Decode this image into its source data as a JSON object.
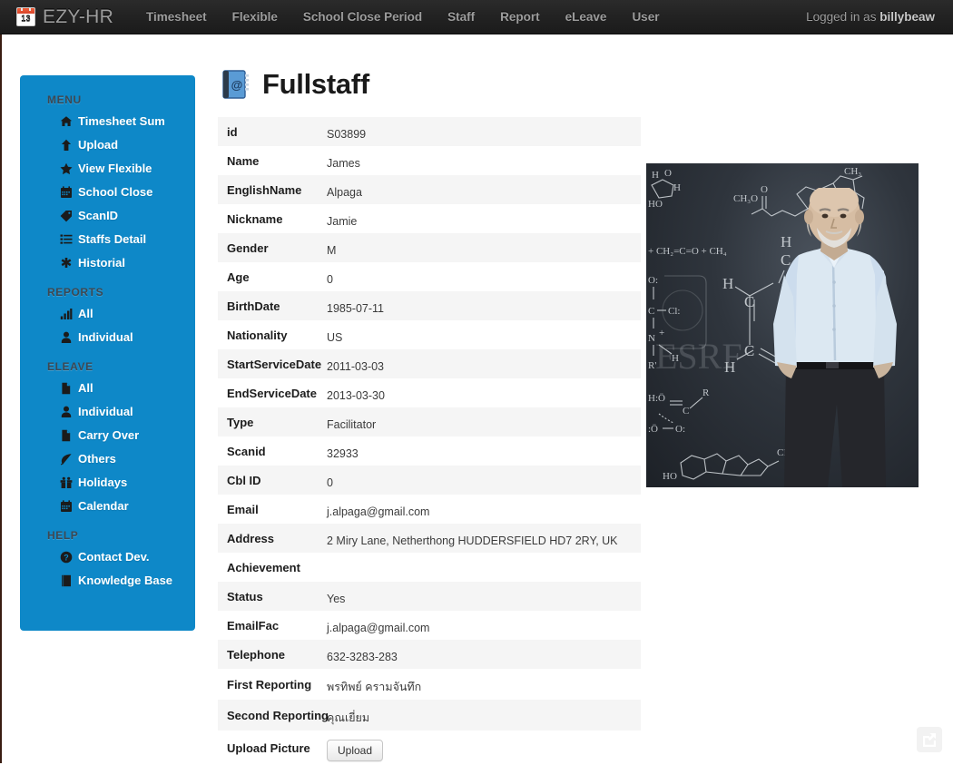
{
  "navbar": {
    "brand": "EZY-HR",
    "brand_icon": "calendar-icon",
    "calendar_day": "13",
    "items": [
      {
        "label": "Timesheet"
      },
      {
        "label": "Flexible"
      },
      {
        "label": "School Close Period"
      },
      {
        "label": "Staff"
      },
      {
        "label": "Report"
      },
      {
        "label": "eLeave"
      },
      {
        "label": "User"
      }
    ],
    "logged_in_prefix": "Logged in as",
    "username": "billybeaw"
  },
  "sidebar": {
    "accent_color": "#0e88c8",
    "sections": [
      {
        "title": "MENU",
        "items": [
          {
            "label": "Timesheet Sum",
            "icon": "home-icon"
          },
          {
            "label": "Upload",
            "icon": "arrow-up-icon"
          },
          {
            "label": "View Flexible",
            "icon": "star-icon"
          },
          {
            "label": "School Close",
            "icon": "calendar-icon"
          },
          {
            "label": "ScanID",
            "icon": "tag-icon"
          },
          {
            "label": "Staffs Detail",
            "icon": "list-icon"
          },
          {
            "label": "Historial",
            "icon": "asterisk-icon"
          }
        ]
      },
      {
        "title": "REPORTS",
        "items": [
          {
            "label": "All",
            "icon": "bar-chart-icon"
          },
          {
            "label": "Individual",
            "icon": "user-icon"
          }
        ]
      },
      {
        "title": "ELEAVE",
        "items": [
          {
            "label": "All",
            "icon": "file-icon"
          },
          {
            "label": "Individual",
            "icon": "user-icon"
          },
          {
            "label": "Carry Over",
            "icon": "file-icon"
          },
          {
            "label": "Others",
            "icon": "leaf-icon"
          },
          {
            "label": "Holidays",
            "icon": "gift-icon"
          },
          {
            "label": "Calendar",
            "icon": "calendar-icon"
          }
        ]
      },
      {
        "title": "HELP",
        "items": [
          {
            "label": "Contact Dev.",
            "icon": "question-circle-icon"
          },
          {
            "label": "Knowledge Base",
            "icon": "book-icon"
          }
        ]
      }
    ]
  },
  "main": {
    "title": "Fullstaff",
    "title_icon": "address-book-icon",
    "fields": [
      {
        "label": "id",
        "value": "S03899"
      },
      {
        "label": "Name",
        "value": "James"
      },
      {
        "label": "EnglishName",
        "value": "Alpaga"
      },
      {
        "label": "Nickname",
        "value": "Jamie"
      },
      {
        "label": "Gender",
        "value": "M"
      },
      {
        "label": "Age",
        "value": "0"
      },
      {
        "label": "BirthDate",
        "value": "1985-07-11"
      },
      {
        "label": "Nationality",
        "value": "US"
      },
      {
        "label": "StartServiceDate",
        "value": "2011-03-03"
      },
      {
        "label": "EndServiceDate",
        "value": "2013-03-30"
      },
      {
        "label": "Type",
        "value": "Facilitator"
      },
      {
        "label": "Scanid",
        "value": "32933"
      },
      {
        "label": "Cbl ID",
        "value": "0"
      },
      {
        "label": "Email",
        "value": "j.alpaga@gmail.com"
      },
      {
        "label": "Address",
        "value": "2 Miry Lane, Netherthong HUDDERSFIELD HD7 2RY, UK"
      },
      {
        "label": "Achievement",
        "value": ""
      },
      {
        "label": "Status",
        "value": "Yes"
      },
      {
        "label": "EmailFac",
        "value": "j.alpaga@gmail.com"
      },
      {
        "label": "Telephone",
        "value": "632-3283-283"
      },
      {
        "label": "First Reporting",
        "value": "พรทิพย์ ครามจันทึก"
      },
      {
        "label": "Second Reporting",
        "value": "คุณเยี่ยม"
      }
    ],
    "upload_label": "Upload Picture",
    "upload_button": "Upload",
    "photo_alt": "staff-photo"
  },
  "footer": {
    "share_icon": "share-export-icon"
  }
}
